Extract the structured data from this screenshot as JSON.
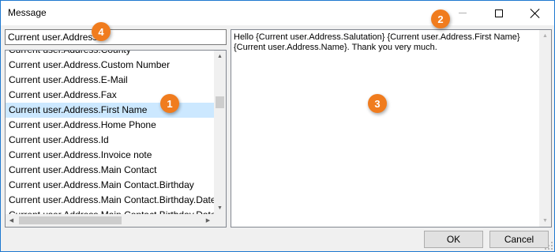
{
  "window": {
    "title": "Message",
    "controls": {
      "minimize_icon": "minimize-icon",
      "maximize_icon": "maximize-icon",
      "close_icon": "close-icon"
    }
  },
  "search": {
    "value": "Current user.Address."
  },
  "list": {
    "items": [
      {
        "label": "Current user.Address.County",
        "selected": false
      },
      {
        "label": "Current user.Address.Custom Number",
        "selected": false
      },
      {
        "label": "Current user.Address.E-Mail",
        "selected": false
      },
      {
        "label": "Current user.Address.Fax",
        "selected": false
      },
      {
        "label": "Current user.Address.First Name",
        "selected": true
      },
      {
        "label": "Current user.Address.Home Phone",
        "selected": false
      },
      {
        "label": "Current user.Address.Id",
        "selected": false
      },
      {
        "label": "Current user.Address.Invoice note",
        "selected": false
      },
      {
        "label": "Current user.Address.Main Contact",
        "selected": false
      },
      {
        "label": "Current user.Address.Main Contact.Birthday",
        "selected": false
      },
      {
        "label": "Current user.Address.Main Contact.Birthday.Date",
        "selected": false
      },
      {
        "label": "Current user.Address.Main Contact.Birthday.Date.Da",
        "selected": false
      }
    ],
    "selected_color": "#cce8ff"
  },
  "message": {
    "line1": "Hello {Current user.Address.Salutation} {Current user.Address.First Name}",
    "line2": "{Current user.Address.Name}. Thank you very much."
  },
  "buttons": {
    "ok": "OK",
    "cancel": "Cancel"
  },
  "callouts": {
    "one": "1",
    "two": "2",
    "three": "3",
    "four": "4",
    "color": "#f07c1e"
  },
  "accent": "#1e78d0"
}
